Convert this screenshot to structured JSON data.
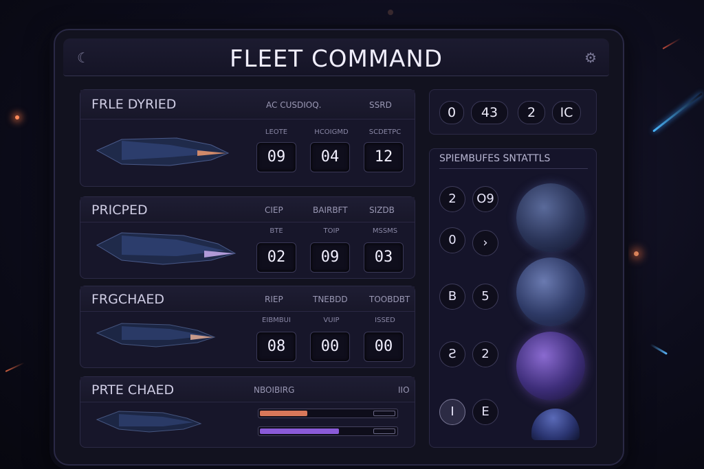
{
  "title": "FLEET COMMAND",
  "header": {
    "left_icon": "crescent-icon",
    "right_icon": "settings-icon"
  },
  "fleets": [
    {
      "name": "FRLE DYRIED",
      "columns": [
        "AC CUSDIOQ.",
        "SSRD"
      ],
      "stat_labels": [
        "LEOTE",
        "HCOIGMD",
        "SCDETPC"
      ],
      "stat_values": [
        "09",
        "04",
        "12"
      ]
    },
    {
      "name": "PRICPED",
      "columns": [
        "CIEP",
        "BAIRBFT",
        "SIZDB"
      ],
      "stat_labels": [
        "BTE",
        "TOIP",
        "MSSMS"
      ],
      "stat_values": [
        "02",
        "09",
        "03"
      ]
    },
    {
      "name": "FRGCHAED",
      "columns": [
        "RIEP",
        "TNEBDD",
        "TOOBDBT"
      ],
      "stat_labels": [
        "EIBMBUI",
        "VUIP",
        "ISSED"
      ],
      "stat_values": [
        "08",
        "00",
        "00"
      ]
    },
    {
      "name": "PRTE CHAED",
      "columns": [
        "NBOIBIRG",
        "IIO"
      ],
      "bars": [
        {
          "name": "bar-1",
          "fill": 0.35,
          "color": "#d9785a"
        },
        {
          "name": "bar-2",
          "fill": 0.58,
          "color": "#8a5ad8"
        }
      ]
    }
  ],
  "stats_strip": [
    "0",
    "43",
    "2",
    "IC"
  ],
  "planet_panel": {
    "title": "SPIEMBUFES SNTATTLS",
    "rows": [
      {
        "a": "2",
        "b": "O9"
      },
      {
        "a": "0",
        "b": "›"
      },
      {
        "a": "B",
        "b": "5"
      },
      {
        "a": "Ƨ",
        "b": "2"
      },
      {
        "a": "I",
        "b": "E"
      }
    ]
  },
  "colors": {
    "accent_orange": "#d9785a",
    "accent_purple": "#8a5ad8",
    "panel_bg": "#12121f"
  }
}
